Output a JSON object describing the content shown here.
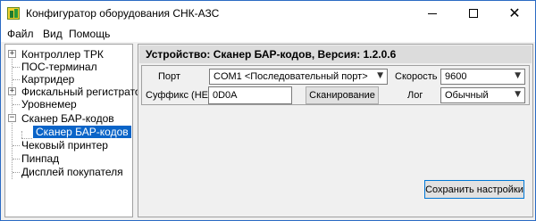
{
  "window": {
    "title": "Конфигуратор оборудования СНК-АЗС",
    "min_symbol": "",
    "close_symbol": "✕"
  },
  "menu": {
    "items": [
      {
        "label": "Файл"
      },
      {
        "label": "Вид"
      },
      {
        "label": "Помощь"
      }
    ]
  },
  "tree": {
    "items": [
      {
        "label": "Контроллер ТРК",
        "expander": "+"
      },
      {
        "label": "ПОС-терминал",
        "expander": ""
      },
      {
        "label": "Картридер",
        "expander": ""
      },
      {
        "label": "Фискальный регистратор",
        "expander": "+"
      },
      {
        "label": "Уровнемер",
        "expander": ""
      },
      {
        "label": "Сканер БАР-кодов",
        "expander": "−"
      },
      {
        "label": "Сканер БАР-кодов",
        "child": true,
        "selected": true
      },
      {
        "label": "Чековый принтер",
        "expander": ""
      },
      {
        "label": "Пинпад",
        "expander": ""
      },
      {
        "label": "Дисплей покупателя",
        "expander": ""
      }
    ]
  },
  "device": {
    "title": "Устройство: Сканер БАР-кодов, Версия: 1.2.0.6"
  },
  "settings": {
    "port_label": "Порт",
    "port_value": "COM1 <Последовательный порт>",
    "speed_label": "Скорость",
    "speed_value": "9600",
    "suffix_label": "Суффикс (HEX)",
    "suffix_value": "0D0A",
    "scan_button": "Сканирование",
    "log_label": "Лог",
    "log_value": "Обычный"
  },
  "footer": {
    "save_button": "Сохранить настройки"
  }
}
